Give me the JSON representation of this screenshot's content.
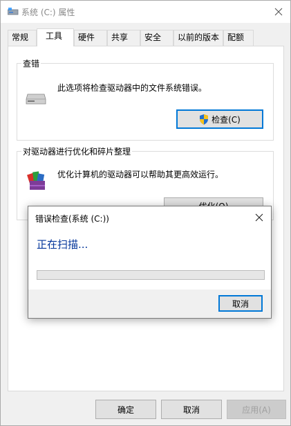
{
  "window": {
    "title": "系统 (C:) 属性"
  },
  "tabs": [
    {
      "label": "常规"
    },
    {
      "label": "工具"
    },
    {
      "label": "硬件"
    },
    {
      "label": "共享"
    },
    {
      "label": "安全"
    },
    {
      "label": "以前的版本"
    },
    {
      "label": "配额"
    }
  ],
  "check_group": {
    "title": "查错",
    "description": "此选项将检查驱动器中的文件系统错误。",
    "button_label": "检查(C)"
  },
  "optimize_group": {
    "title": "对驱动器进行优化和碎片整理",
    "description": "优化计算机的驱动器可以帮助其更高效运行。",
    "button_label": "优化(O)"
  },
  "footer": {
    "ok_label": "确定",
    "cancel_label": "取消",
    "apply_label": "应用(A)"
  },
  "dialog": {
    "title": "错误检查(系统 (C:))",
    "status": "正在扫描...",
    "progress": 0,
    "cancel_label": "取消"
  },
  "colors": {
    "accent": "#0078d7",
    "status_text": "#003399"
  }
}
